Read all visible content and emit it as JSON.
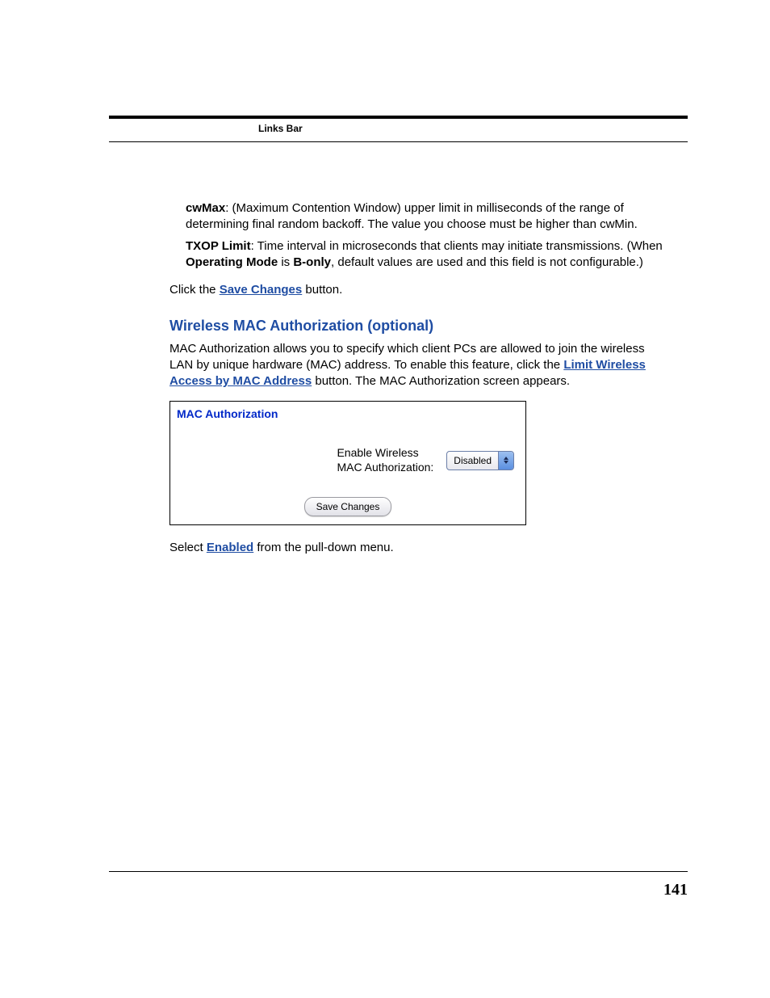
{
  "header": {
    "links_bar": "Links Bar"
  },
  "defs": {
    "cwmax_label": "cwMax",
    "cwmax_text": ": (Maximum Contention Window) upper limit in milliseconds of the range of determining final random backoff. The value you choose must be higher than cwMin.",
    "txop_label": "TXOP Limit",
    "txop_text1": ": Time interval in microseconds that clients may initiate transmissions. (When ",
    "txop_bold1": "Operating Mode",
    "txop_text2": " is ",
    "txop_bold2": "B-only",
    "txop_text3": ", default values are used and this field is not configurable.)"
  },
  "save_line": {
    "prefix": "Click the ",
    "link": "Save Changes",
    "suffix": " button."
  },
  "section": {
    "heading": "Wireless MAC Authorization (optional)",
    "para_prefix": "MAC Authorization allows you to specify which client PCs are allowed to join the wireless LAN by unique hardware (MAC) address. To enable this feature, click the ",
    "para_link": "Limit Wireless Access by MAC Address",
    "para_suffix": " button. The MAC Authorization screen appears."
  },
  "panel": {
    "title": "MAC Authorization",
    "field_label_line1": "Enable Wireless",
    "field_label_line2": "MAC Authorization:",
    "selected_value": "Disabled",
    "save_button": "Save Changes"
  },
  "closing": {
    "prefix": "Select ",
    "link": "Enabled",
    "suffix": " from the pull-down menu."
  },
  "page_number": "141"
}
